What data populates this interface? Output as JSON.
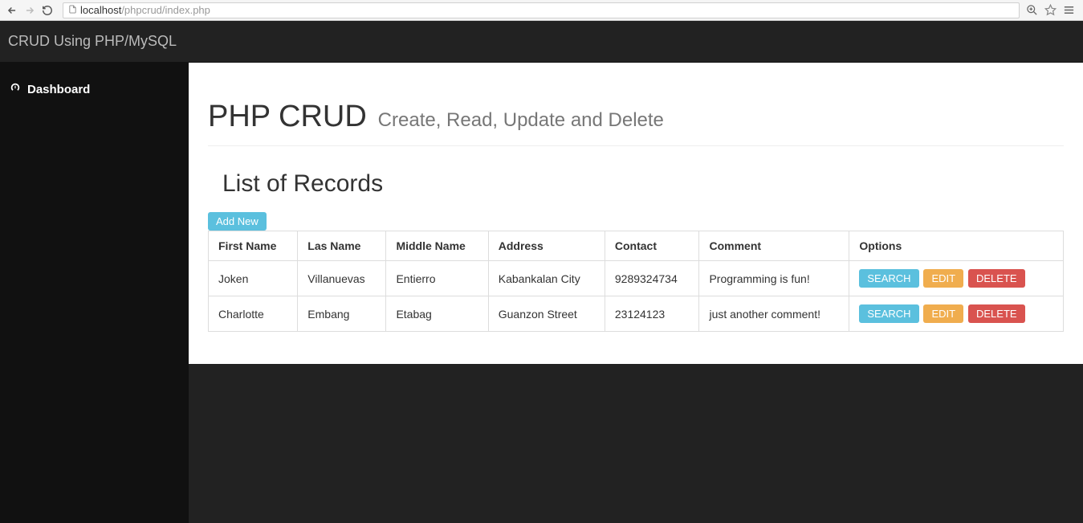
{
  "browser": {
    "url_host": "localhost",
    "url_path": "/phpcrud/index.php"
  },
  "navbar": {
    "brand": "CRUD Using PHP/MySQL"
  },
  "sidebar": {
    "items": [
      {
        "label": "Dashboard"
      }
    ]
  },
  "main": {
    "title": "PHP CRUD",
    "subtitle": "Create, Read, Update and Delete",
    "listHeader": "List of Records",
    "addNew": "Add New",
    "columns": [
      "First Name",
      "Las Name",
      "Middle Name",
      "Address",
      "Contact",
      "Comment",
      "Options"
    ],
    "rows": [
      {
        "first": "Joken",
        "last": "Villanuevas",
        "middle": "Entierro",
        "address": "Kabankalan City",
        "contact": "9289324734",
        "comment": "Programming is fun!"
      },
      {
        "first": "Charlotte",
        "last": "Embang",
        "middle": "Etabag",
        "address": "Guanzon Street",
        "contact": "23124123",
        "comment": "just another comment!"
      }
    ],
    "buttons": {
      "search": "SEARCH",
      "edit": "EDIT",
      "delete": "DELETE"
    }
  }
}
